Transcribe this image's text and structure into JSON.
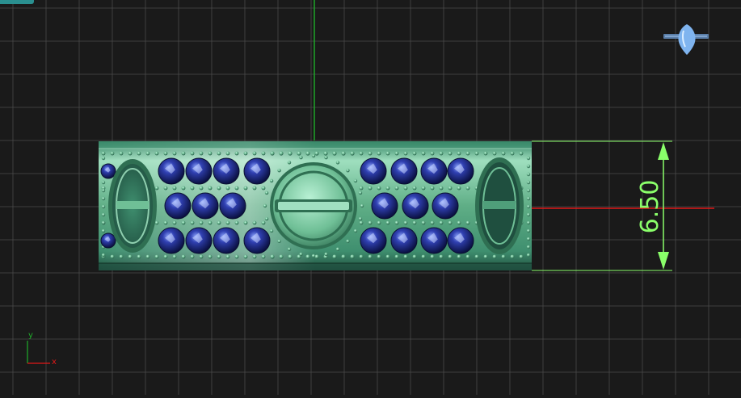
{
  "viewport": {
    "background": "#1a1a1a",
    "grid_color": "#4a4a4a",
    "y_axis_color": "#1fae2a",
    "x_axis_color": "#e01818",
    "dimension_color": "#8aff6a"
  },
  "dimension": {
    "value": "6.50"
  },
  "axis_indicator": {
    "y_label": "y",
    "x_label": "x"
  },
  "view_cube": {
    "icon": "view-orientation-icon",
    "color": "#7fb4ef"
  },
  "model": {
    "name": "ring-band-model",
    "metal_color": "#5fbf8f",
    "gem_color": "#1f2f8f",
    "ring_rows": 3
  }
}
